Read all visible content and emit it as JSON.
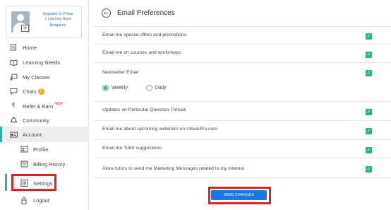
{
  "profile": {
    "upgrade_link": "Upgrade to Prime",
    "learning_need_count": "1 Learning Need",
    "location": "Bangalore"
  },
  "sidebar": {
    "items": [
      {
        "label": "Home",
        "icon": "home-icon"
      },
      {
        "label": "Learning Needs",
        "icon": "book-icon"
      },
      {
        "label": "My Classes",
        "icon": "classroom-icon"
      },
      {
        "label": "Chats",
        "icon": "chat-icon",
        "badge": "2"
      },
      {
        "label": "Refer & Earn",
        "icon": "rupee-icon",
        "tag": "NEW"
      },
      {
        "label": "Community",
        "icon": "community-icon"
      },
      {
        "label": "Account",
        "icon": "account-card-icon"
      },
      {
        "label": "Profile",
        "icon": "profile-icon"
      },
      {
        "label": "Billing History",
        "icon": "billing-icon"
      },
      {
        "label": "Settings",
        "icon": "settings-icon",
        "active": true
      },
      {
        "label": "Logout",
        "icon": "lock-icon"
      }
    ]
  },
  "header": {
    "title": "Email Preferences"
  },
  "preferences": [
    {
      "label": "Email me special offers and promotions.",
      "checked": true
    },
    {
      "label": "Email me on courses and workshops.",
      "checked": true
    },
    {
      "label": "Newsletter Email",
      "checked": true
    },
    {
      "label": "Updates on Particular Question Thread.",
      "checked": true
    },
    {
      "label": "Email me about upcoming webinars on UrbanPro.com.",
      "checked": true
    },
    {
      "label": "Email me Tutor suggestions",
      "checked": true
    },
    {
      "label": "Allow tutors to send me Marketing Messages related to my Interest",
      "checked": true
    }
  ],
  "newsletter_frequency": {
    "options": [
      "Weekly",
      "Daily"
    ],
    "selected": "Weekly"
  },
  "save_button": "SAVE CHANGES",
  "colors": {
    "accent_green": "#2bb673",
    "primary_blue": "#1976e3",
    "highlight_red": "#e41e26",
    "active_bar": "#2bb2a8"
  }
}
